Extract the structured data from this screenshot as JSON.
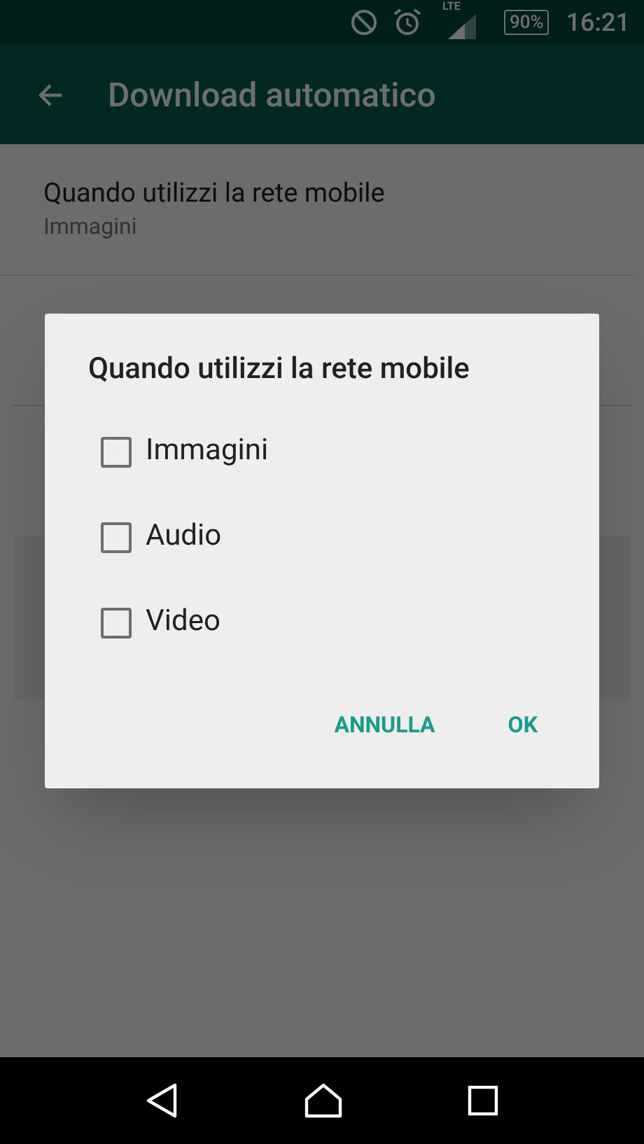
{
  "status_bar": {
    "network": "LTE",
    "battery": "90%",
    "time": "16:21"
  },
  "app_bar": {
    "title": "Download automatico"
  },
  "settings": [
    {
      "title": "Quando utilizzi la rete mobile",
      "summary": "Immagini"
    }
  ],
  "dialog": {
    "title": "Quando utilizzi la rete mobile",
    "options": [
      {
        "label": "Immagini",
        "checked": false
      },
      {
        "label": "Audio",
        "checked": false
      },
      {
        "label": "Video",
        "checked": false
      }
    ],
    "buttons": [
      "ANNULLA",
      "OK"
    ]
  }
}
